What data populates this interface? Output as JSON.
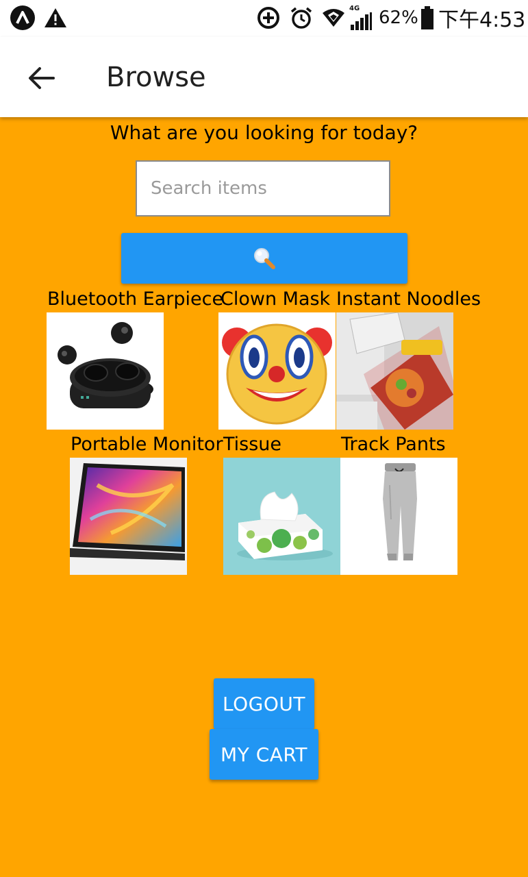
{
  "status_bar": {
    "battery": "62%",
    "network": "4G",
    "time": "下午4:53"
  },
  "app_bar": {
    "title": "Browse",
    "back_icon": "arrow-left-icon"
  },
  "main": {
    "prompt": "What are you looking for today?",
    "search": {
      "placeholder": "Search items",
      "value": ""
    },
    "search_button_icon": "magnifier-icon",
    "items": [
      {
        "label": "Bluetooth Earpiece",
        "image": "earbuds-case-image"
      },
      {
        "label": "Clown Mask",
        "image": "clown-face-image"
      },
      {
        "label": "Instant Noodles",
        "image": "noodle-pack-image"
      },
      {
        "label": "Portable Monitor",
        "image": "monitor-image"
      },
      {
        "label": "Tissue",
        "image": "tissue-box-image"
      },
      {
        "label": "Track Pants",
        "image": "track-pants-image"
      }
    ]
  },
  "actions": {
    "logout": "LOGOUT",
    "cart": "MY CART"
  },
  "colors": {
    "background": "#FFA500",
    "accent": "#2196F3",
    "app_bar": "#FFFFFF"
  }
}
